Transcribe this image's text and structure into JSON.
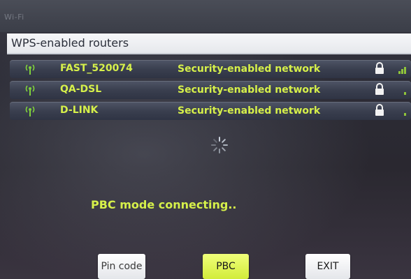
{
  "window": {
    "label": "Wi-Fi"
  },
  "header": {
    "title": "WPS-enabled routers"
  },
  "networks": [
    {
      "ssid": "FAST_520074",
      "security": "Security-enabled network",
      "signal_bars": 3,
      "signal_icon": "wifi-signal-icon",
      "lock_icon": "lock-icon"
    },
    {
      "ssid": "QA-DSL",
      "security": "Security-enabled network",
      "signal_bars": 1,
      "signal_icon": "wifi-signal-icon",
      "lock_icon": "lock-icon"
    },
    {
      "ssid": "D-LINK",
      "security": "Security-enabled network",
      "signal_bars": 1,
      "signal_icon": "wifi-signal-icon",
      "lock_icon": "lock-icon"
    }
  ],
  "status": {
    "text": "PBC mode connecting..",
    "spinner_icon": "loading-spinner-icon"
  },
  "buttons": {
    "pin_code": "Pin code",
    "pbc": "PBC",
    "exit": "EXIT"
  },
  "colors": {
    "accent": "#d6f04a",
    "header_bg": "#f2f3f5",
    "row_bg": "#3f4555"
  }
}
